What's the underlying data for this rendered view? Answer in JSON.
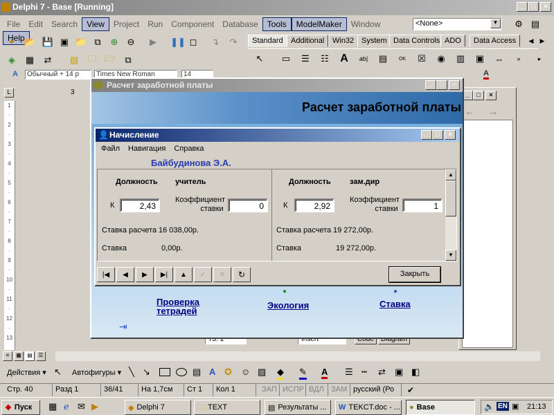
{
  "ide": {
    "title": "Delphi 7 - Base [Running]",
    "menu": [
      "File",
      "Edit",
      "Search",
      "View",
      "Project",
      "Run",
      "Component",
      "Database",
      "Tools",
      "ModelMaker",
      "Window",
      "Help"
    ],
    "selected_object": "<None>",
    "palette_tabs": [
      "Standard",
      "Additional",
      "Win32",
      "System",
      "Data Controls",
      "ADO",
      "Data Access"
    ]
  },
  "word": {
    "style": "Обычный + 14 р",
    "font": "Times New Roman",
    "size": "14",
    "ruler_mark": "3",
    "status": [
      "Стр. 40",
      "Разд 1",
      "36/41",
      "На 1,7см",
      "Ст 1",
      "Кол 1",
      "ЗАП",
      "ИСПР",
      "ВДЛ",
      "ЗАМ",
      "русский (Ро"
    ],
    "drawing_actions": "Действия",
    "autoshapes": "Автофигуры",
    "table_fragment": "73.  1",
    "table_fragment2": "Insert",
    "editor_tabs": [
      "Code",
      "Diagram"
    ]
  },
  "main_form": {
    "title": "Расчет заработной платы",
    "banner": "Расчет заработной платы",
    "links": [
      "Проверка тетрадей",
      "Экология",
      "Ставка"
    ],
    "link1_lines": [
      "Проверка",
      "тетрадей"
    ]
  },
  "dialog": {
    "title": "Начисление",
    "menu": [
      "Файл",
      "Навигация",
      "Справка"
    ],
    "employee": "Байбудинова Э.А.",
    "records": [
      {
        "position_label": "Должность",
        "position": "учитель",
        "k_label": "К",
        "k": "2,43",
        "coef_label": "Коэффициент ставки",
        "coef_l1": "Коэффициент",
        "coef_l2": "ставки",
        "coef": "0",
        "rate_calc_label": "Ставка расчета",
        "rate_calc": "16 038,00р.",
        "rate_label": "Ставка",
        "rate": "0,00р."
      },
      {
        "position_label": "Должность",
        "position": "зам.дир",
        "k_label": "К",
        "k": "2,92",
        "coef_label": "Коэффициент ставки",
        "coef_l1": "Коэффициент",
        "coef_l2": "ставки",
        "coef": "1",
        "rate_calc_label": "Ставка расчета",
        "rate_calc": "19 272,00р.",
        "rate_label": "Ставка",
        "rate": "19 272,00р."
      }
    ],
    "close_label": "Закрыть"
  },
  "taskbar": {
    "start": "Пуск",
    "tasks": [
      "Delphi 7",
      "TEXT",
      "Результаты ...",
      "TEKCT.doc - ...",
      "Base"
    ],
    "lang": "EN",
    "clock": "21:13"
  },
  "colors": {
    "titlebar_active": "#0a246a",
    "titlebar_active_end": "#a6caf0",
    "titlebar_inactive": "#808080",
    "link": "#000080",
    "desktop": "#d4d0c8"
  }
}
